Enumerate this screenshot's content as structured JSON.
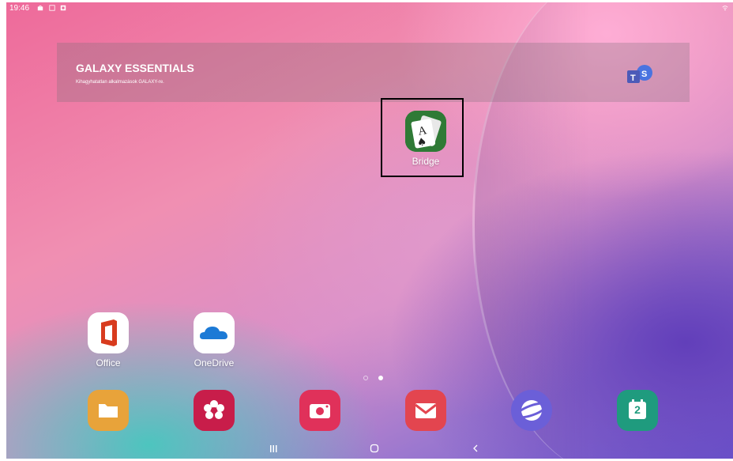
{
  "status_bar": {
    "time": "19:46"
  },
  "banner": {
    "title": "GALAXY ESSENTIALS",
    "subtitle": "Kihagyhatatlan alkalmazások GALAXY-re."
  },
  "home_apps": [
    {
      "label": "Bridge",
      "icon": "bridge-cards-icon"
    },
    {
      "label": "Office",
      "icon": "office-icon"
    },
    {
      "label": "OneDrive",
      "icon": "onedrive-icon"
    }
  ],
  "dock": [
    {
      "icon": "my-files-icon",
      "color": "#e8a33a"
    },
    {
      "icon": "gallery-icon",
      "color": "#c81d4a"
    },
    {
      "icon": "camera-icon",
      "color": "#e0315a"
    },
    {
      "icon": "email-icon",
      "color": "#e3454f"
    },
    {
      "icon": "internet-icon",
      "color": "#6b5fd8"
    },
    {
      "icon": "calendar-icon",
      "color": "#1f9b7e",
      "text": "2"
    }
  ],
  "page_indicator": {
    "pages": 2,
    "current": 2
  }
}
